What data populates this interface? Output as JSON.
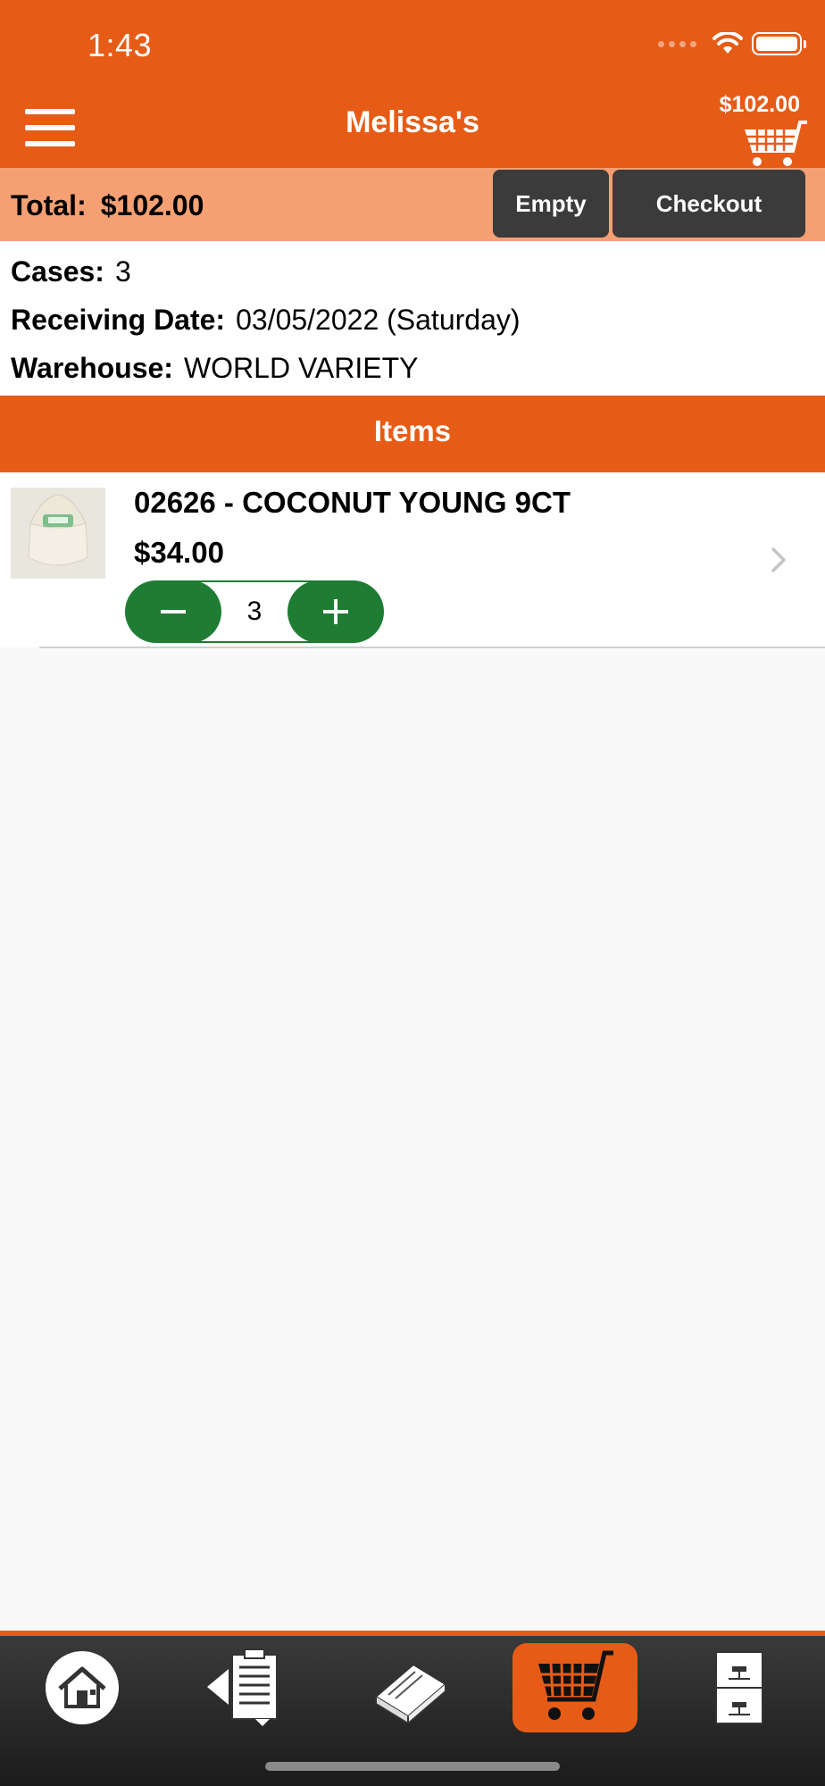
{
  "status_bar": {
    "time": "1:43"
  },
  "header": {
    "title": "Melissa's",
    "cart_total": "$102.00"
  },
  "summary": {
    "total_label": "Total:",
    "total_value": "$102.00",
    "empty_label": "Empty",
    "checkout_label": "Checkout"
  },
  "order_info": {
    "cases_label": "Cases:",
    "cases_value": "3",
    "receiving_label": "Receiving Date:",
    "receiving_value": "03/05/2022 (Saturday)",
    "warehouse_label": "Warehouse:",
    "warehouse_value": "WORLD VARIETY"
  },
  "items_section": {
    "title": "Items",
    "items": [
      {
        "name": "02626 - COCONUT YOUNG 9CT",
        "price": "$34.00",
        "quantity": "3",
        "thumbnail_icon": "coconut-thumbnail"
      }
    ]
  },
  "tab_bar": {
    "tabs": [
      {
        "icon": "home-icon",
        "active": false
      },
      {
        "icon": "clipboard-back-icon",
        "active": false
      },
      {
        "icon": "catalog-book-icon",
        "active": false
      },
      {
        "icon": "cart-icon",
        "active": true
      },
      {
        "icon": "file-cabinet-icon",
        "active": false
      }
    ]
  },
  "colors": {
    "brand_orange": "#e65c17",
    "summary_bar": "#f5a073",
    "stepper_green": "#1e7d32",
    "dark_button": "#3b3b3b"
  }
}
